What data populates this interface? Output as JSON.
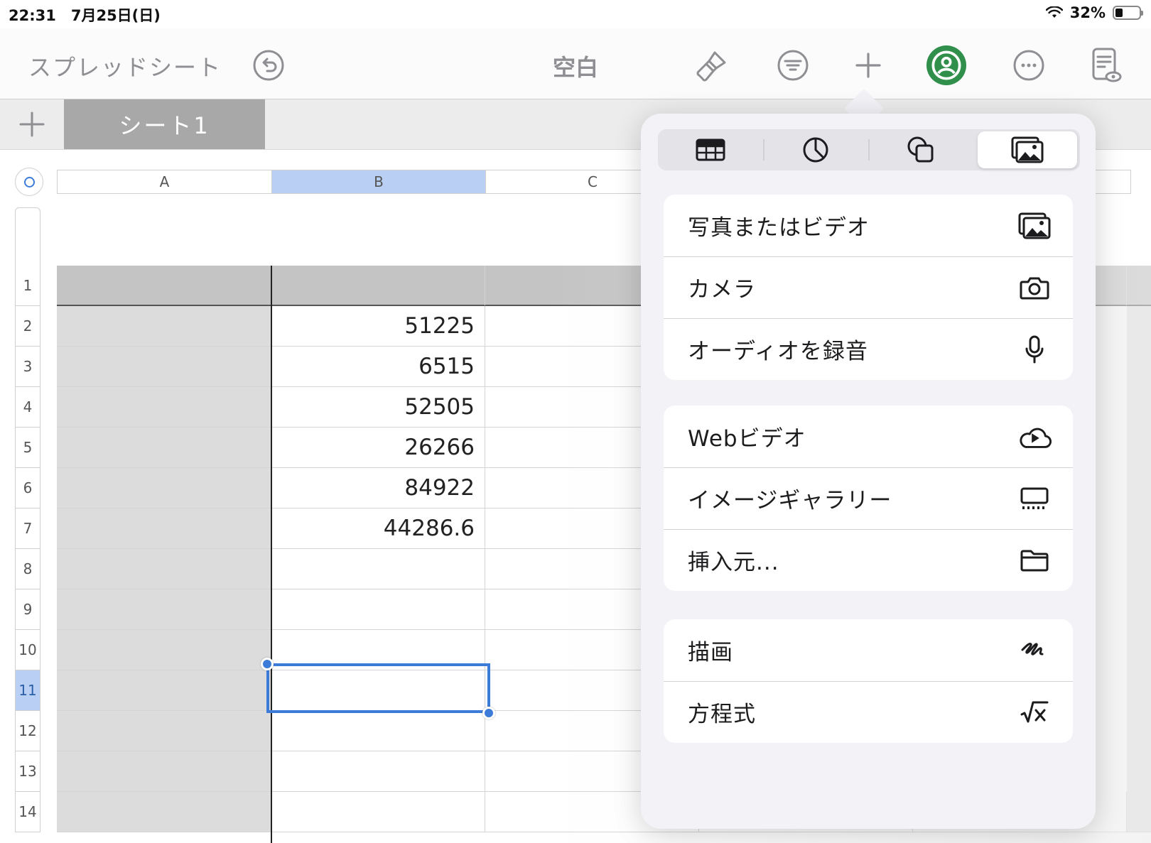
{
  "status_bar": {
    "time_date": "22:31　7月25日(日)",
    "battery_percent": "32%",
    "battery_level": 0.32
  },
  "toolbar": {
    "back_label": "スプレッドシート",
    "doc_title": "空白",
    "icons": [
      "undo-icon",
      "paintbrush-icon",
      "filter-icon",
      "plus-icon",
      "collaboration-icon",
      "more-icon",
      "reader-view-icon"
    ],
    "accent_color": "#2f8f4b"
  },
  "tabs": {
    "sheet_name": "シート1"
  },
  "columns": [
    "A",
    "B",
    "C"
  ],
  "rows": [
    "1",
    "2",
    "3",
    "4",
    "5",
    "6",
    "7",
    "8",
    "9",
    "10",
    "11",
    "12",
    "13",
    "14"
  ],
  "cells": {
    "B2": "51225",
    "B3": "6515",
    "B4": "52505",
    "B5": "26266",
    "B6": "84922",
    "B7": "44286.6"
  },
  "selection": {
    "cell": "B11",
    "color": "#3d7bd9"
  },
  "insert_menu": {
    "tabs": [
      "table-icon",
      "chart-icon",
      "shapes-icon",
      "media-icon"
    ],
    "active_tab": "media-icon",
    "groups": [
      [
        {
          "label": "写真またはビデオ",
          "icon": "photo-icon"
        },
        {
          "label": "カメラ",
          "icon": "camera-icon"
        },
        {
          "label": "オーディオを録音",
          "icon": "microphone-icon"
        }
      ],
      [
        {
          "label": "Webビデオ",
          "icon": "cloud-play-icon"
        },
        {
          "label": "イメージギャラリー",
          "icon": "gallery-icon"
        },
        {
          "label": "挿入元...",
          "icon": "folder-icon"
        }
      ],
      [
        {
          "label": "描画",
          "icon": "draw-icon"
        },
        {
          "label": "方程式",
          "icon": "equation-icon"
        }
      ]
    ]
  }
}
